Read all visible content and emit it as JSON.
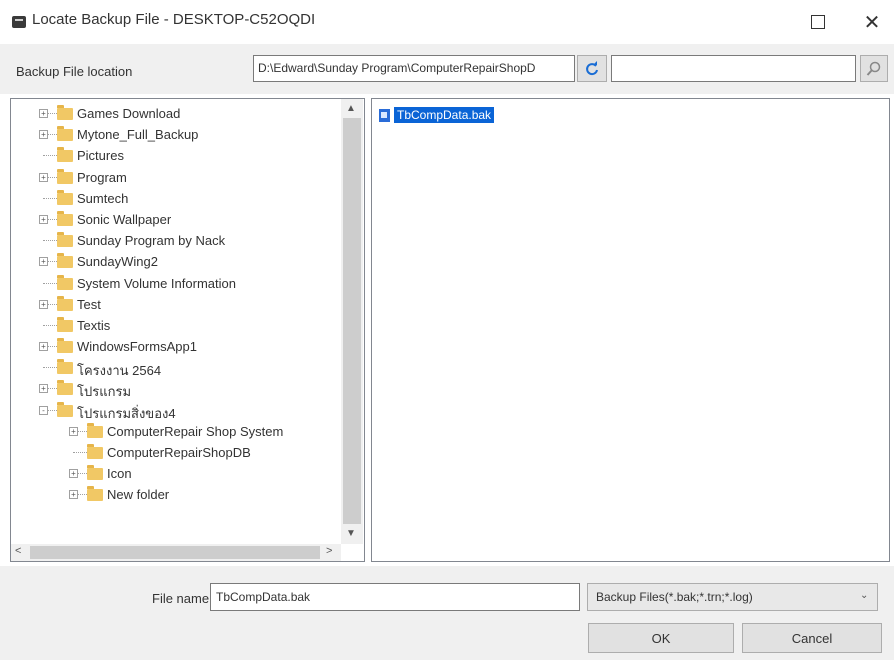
{
  "window": {
    "title": "Locate Backup File - DESKTOP-C52OQDI",
    "maximize_icon": "maximize-icon",
    "close_glyph": "✕"
  },
  "location": {
    "label": "Backup File location",
    "path": "D:\\Edward\\Sunday Program\\ComputerRepairShopD",
    "refresh_icon": "refresh-icon",
    "search_value": "",
    "search_icon": "search-icon"
  },
  "tree": {
    "items": [
      {
        "label": "Games Download",
        "level": 0,
        "expander": "+"
      },
      {
        "label": "Mytone_Full_Backup",
        "level": 0,
        "expander": "+"
      },
      {
        "label": "Pictures",
        "level": 0,
        "expander": ""
      },
      {
        "label": "Program",
        "level": 0,
        "expander": "+"
      },
      {
        "label": "Sumtech",
        "level": 0,
        "expander": ""
      },
      {
        "label": "Sonic Wallpaper",
        "level": 0,
        "expander": "+"
      },
      {
        "label": "Sunday Program by Nack",
        "level": 0,
        "expander": ""
      },
      {
        "label": "SundayWing2",
        "level": 0,
        "expander": "+"
      },
      {
        "label": "System Volume Information",
        "level": 0,
        "expander": ""
      },
      {
        "label": "Test",
        "level": 0,
        "expander": "+"
      },
      {
        "label": "Textis",
        "level": 0,
        "expander": ""
      },
      {
        "label": "WindowsFormsApp1",
        "level": 0,
        "expander": "+"
      },
      {
        "label": "โครงงาน 2564",
        "level": 0,
        "expander": ""
      },
      {
        "label": "โปรแกรม",
        "level": 0,
        "expander": "+"
      },
      {
        "label": "โปรแกรมสิ่งของ4",
        "level": 0,
        "expander": "-"
      },
      {
        "label": "ComputerRepair Shop System",
        "level": 1,
        "expander": "+"
      },
      {
        "label": "ComputerRepairShopDB",
        "level": 1,
        "expander": ""
      },
      {
        "label": "Icon",
        "level": 1,
        "expander": "+"
      },
      {
        "label": "New folder",
        "level": 1,
        "expander": "+"
      }
    ],
    "scroll_up_glyph": "▲",
    "scroll_down_glyph": "▼",
    "scroll_left_glyph": "<",
    "scroll_right_glyph": ">"
  },
  "files": {
    "items": [
      {
        "name": "TbCompData.bak",
        "selected": true
      }
    ],
    "selected_color": "#0a64d6"
  },
  "bottom": {
    "filename_label": "File name:",
    "filename_value": "TbCompData.bak",
    "filetype_value": "Backup Files(*.bak;*.trn;*.log)",
    "filetype_chevron": "⌄",
    "ok_label": "OK",
    "cancel_label": "Cancel"
  }
}
